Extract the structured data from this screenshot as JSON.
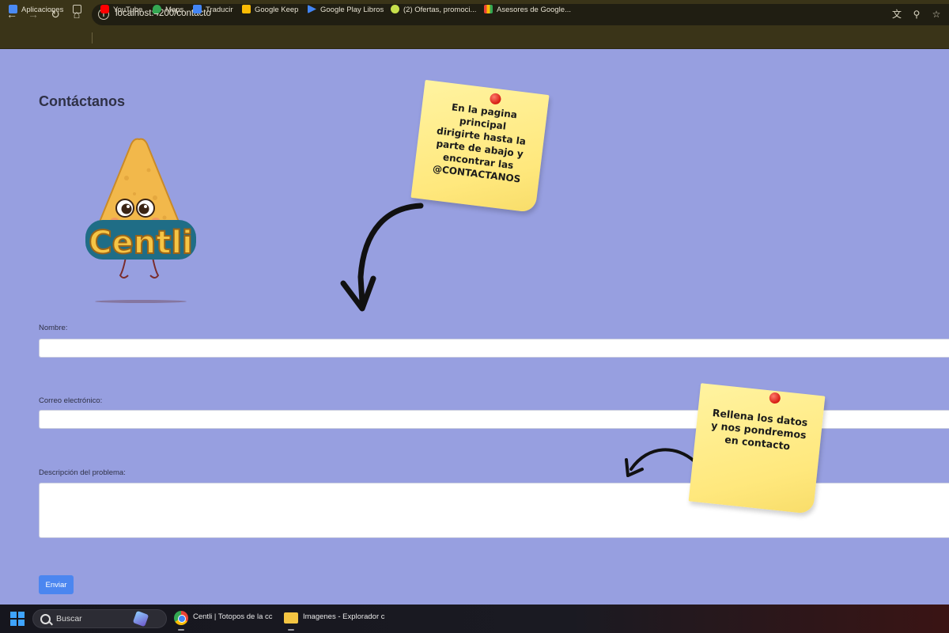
{
  "browser": {
    "url": "localhost:4200/contacto",
    "bookmarks": [
      {
        "label": "Aplicaciones",
        "icon": "apps-grid-icon",
        "color": "#4a8af4"
      },
      {
        "label": "YouTube",
        "icon": "youtube-icon",
        "color": "#ff0000"
      },
      {
        "label": "Maps",
        "icon": "maps-icon",
        "color": "#34a853"
      },
      {
        "label": "Traducir",
        "icon": "translate-icon",
        "color": "#4285f4"
      },
      {
        "label": "Google Keep",
        "icon": "keep-icon",
        "color": "#fbbc04"
      },
      {
        "label": "Google Play Libros",
        "icon": "play-books-icon",
        "color": "#4285f4"
      },
      {
        "label": "(2) Ofertas, promoci...",
        "icon": "offers-icon",
        "color": "#c7e04b"
      },
      {
        "label": "Asesores de Google...",
        "icon": "google-ads-icon",
        "color": "#ea4335"
      }
    ]
  },
  "page": {
    "title": "Contáctanos",
    "logo_text": "Centli",
    "form": {
      "name_label": "Nombre:",
      "email_label": "Correo electrónico:",
      "description_label": "Descripción del problema:",
      "submit_label": "Enviar"
    }
  },
  "notes": {
    "top_note": [
      "En la pagina",
      "principal",
      "dirigirte hasta la",
      "parte de abajo y",
      "encontrar las",
      "@CONTACTANOS"
    ],
    "bottom_note": [
      "Rellena los datos",
      "y nos pondremos",
      "en contacto"
    ]
  },
  "taskbar": {
    "search_label": "Buscar",
    "tasks": [
      {
        "label": "Centli | Totopos de la cc",
        "icon": "chrome-icon"
      },
      {
        "label": "Imagenes - Explorador c",
        "icon": "folder-icon"
      }
    ]
  },
  "colors": {
    "page_background": "#979fe0",
    "submit_button": "#4b86f0",
    "sticky_note": "#ffe87d",
    "pin": "#d51b12"
  }
}
